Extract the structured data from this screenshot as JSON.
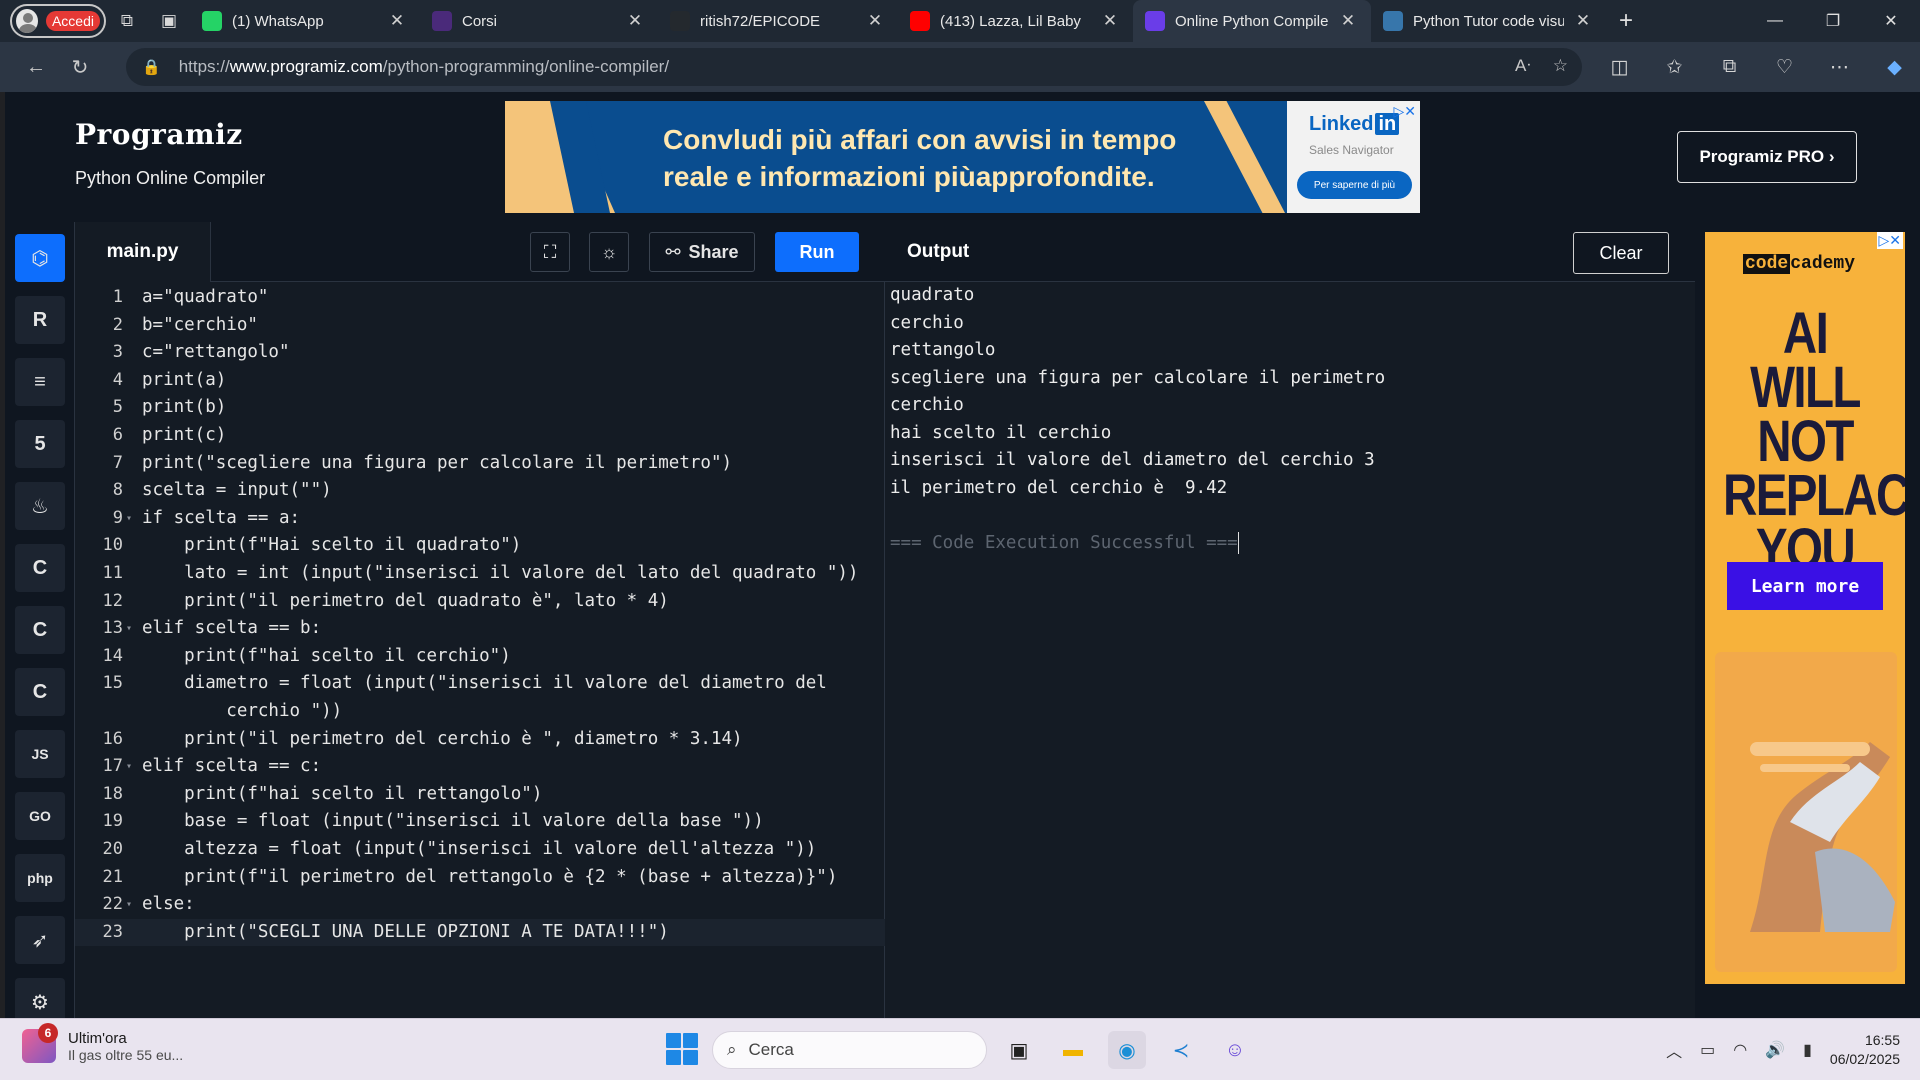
{
  "browser": {
    "profile_label": "Accedi",
    "tabs": [
      {
        "title": "(1) WhatsApp",
        "icon": "whatsapp-icon",
        "color": "#25d366"
      },
      {
        "title": "Corsi",
        "icon": "corsi-icon",
        "color": "#4a2a7a"
      },
      {
        "title": "ritish72/EPICODE",
        "icon": "github-icon",
        "color": "#24292e"
      },
      {
        "title": "(413) Lazza, Lil Baby",
        "icon": "youtube-icon",
        "color": "#ff0000"
      },
      {
        "title": "Online Python Compiler",
        "icon": "programiz-icon",
        "color": "#6a3de8"
      },
      {
        "title": "Python Tutor code visua",
        "icon": "python-icon",
        "color": "#3776ab"
      }
    ],
    "url_prefix": "https://",
    "url_host": "www.programiz.com",
    "url_path": "/python-programming/online-compiler/"
  },
  "site": {
    "logo": "Programiz",
    "subtitle": "Python Online Compiler",
    "pro_button": "Programiz PRO ›",
    "banner_ad": {
      "headline": "Convludi più affari con avvisi in tempo reale e informazioni piùapprofondite.",
      "brand": "Linked",
      "brand_in": "in",
      "product": "Sales Navigator",
      "cta": "Per saperne di più"
    }
  },
  "rail": [
    "python",
    "r",
    "sql",
    "html",
    "java",
    "c",
    "cpp",
    "csharp",
    "JS",
    "GO",
    "php",
    "swift",
    "rust"
  ],
  "editor": {
    "filename": "main.py",
    "share_label": "Share",
    "run_label": "Run",
    "lines": [
      {
        "n": "1",
        "text": "a=\"quadrato\""
      },
      {
        "n": "2",
        "text": "b=\"cerchio\""
      },
      {
        "n": "3",
        "text": "c=\"rettangolo\""
      },
      {
        "n": "4",
        "text": "print(a)"
      },
      {
        "n": "5",
        "text": "print(b)"
      },
      {
        "n": "6",
        "text": "print(c)"
      },
      {
        "n": "7",
        "text": "print(\"scegliere una figura per calcolare il perimetro\")"
      },
      {
        "n": "8",
        "text": "scelta = input(\"\")"
      },
      {
        "n": "9",
        "text": "if scelta == a:"
      },
      {
        "n": "10",
        "text": "    print(f\"Hai scelto il quadrato\")"
      },
      {
        "n": "11",
        "text": "    lato = int (input(\"inserisci il valore del lato del quadrato \"))"
      },
      {
        "n": "12",
        "text": "    print(\"il perimetro del quadrato è\", lato * 4)"
      },
      {
        "n": "13",
        "text": "elif scelta == b:"
      },
      {
        "n": "14",
        "text": "    print(f\"hai scelto il cerchio\")"
      },
      {
        "n": "15",
        "text": "    diametro = float (input(\"inserisci il valore del diametro del"
      },
      {
        "n": "",
        "text": "        cerchio \"))"
      },
      {
        "n": "16",
        "text": "    print(\"il perimetro del cerchio è \", diametro * 3.14)"
      },
      {
        "n": "17",
        "text": "elif scelta == c:"
      },
      {
        "n": "18",
        "text": "    print(f\"hai scelto il rettangolo\")"
      },
      {
        "n": "19",
        "text": "    base = float (input(\"inserisci il valore della base \"))"
      },
      {
        "n": "20",
        "text": "    altezza = float (input(\"inserisci il valore dell'altezza \"))"
      },
      {
        "n": "21",
        "text": "    print(f\"il perimetro del rettangolo è {2 * (base + altezza)}\")"
      },
      {
        "n": "22",
        "text": "else:"
      },
      {
        "n": "23",
        "text": "    print(\"SCEGLI UNA DELLE OPZIONI A TE DATA!!!\")"
      }
    ]
  },
  "output": {
    "title": "Output",
    "clear_label": "Clear",
    "lines": [
      "quadrato",
      "cerchio",
      "rettangolo",
      "scegliere una figura per calcolare il perimetro",
      "cerchio",
      "hai scelto il cerchio",
      "inserisci il valore del diametro del cerchio 3",
      "il perimetro del cerchio è  9.42",
      "",
      "=== Code Execution Successful ==="
    ]
  },
  "side_ad": {
    "brand_a": "code",
    "brand_b": "cademy",
    "headline": [
      "AI WILL",
      "NOT",
      "REPLACE",
      "YOU"
    ],
    "cta": "Learn more"
  },
  "taskbar": {
    "news_badge": "6",
    "news_title": "Ultim'ora",
    "news_text": "Il gas oltre 55 eu...",
    "search_label": "Cerca",
    "time": "16:55",
    "date": "06/02/2025"
  }
}
